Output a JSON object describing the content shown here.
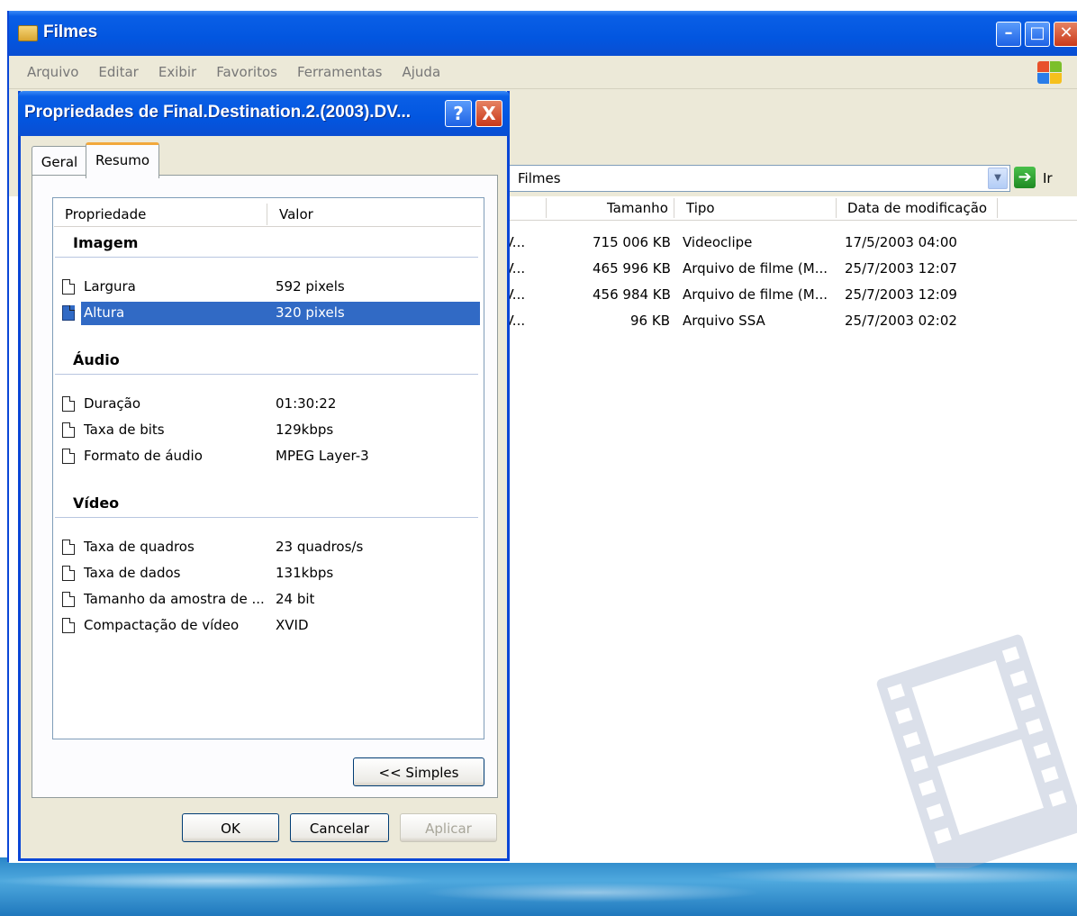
{
  "explorer": {
    "title": "Filmes",
    "menu": [
      "Arquivo",
      "Editar",
      "Exibir",
      "Favoritos",
      "Ferramentas",
      "Ajuda"
    ],
    "address": "Filmes",
    "go_label": "Ir",
    "columns": {
      "tamanho": "Tamanho",
      "tipo": "Tipo",
      "data": "Data de modificação"
    },
    "files": [
      {
        "name": "CV...",
        "size": "715 006 KB",
        "type": "Videoclipe",
        "date": "17/5/2003 04:00"
      },
      {
        "name": "CV...",
        "size": "465 996 KB",
        "type": "Arquivo de filme (M...",
        "date": "25/7/2003 12:07"
      },
      {
        "name": "CV...",
        "size": "456 984 KB",
        "type": "Arquivo de filme (M...",
        "date": "25/7/2003 12:09"
      },
      {
        "name": "CV...",
        "size": "96 KB",
        "type": "Arquivo SSA",
        "date": "25/7/2003 02:02"
      }
    ]
  },
  "dialog": {
    "title": "Propriedades de Final.Destination.2.(2003).DV...",
    "help_label": "?",
    "close_label": "X",
    "tabs": [
      "Geral",
      "Resumo"
    ],
    "list_header": {
      "propriedade": "Propriedade",
      "valor": "Valor"
    },
    "groups": {
      "imagem": "Imagem",
      "audio": "Áudio",
      "video": "Vídeo"
    },
    "imagem_rows": [
      {
        "name": "Largura",
        "value": "592 pixels"
      },
      {
        "name": "Altura",
        "value": "320 pixels"
      }
    ],
    "audio_rows": [
      {
        "name": "Duração",
        "value": "01:30:22"
      },
      {
        "name": "Taxa de bits",
        "value": "129kbps"
      },
      {
        "name": "Formato de áudio",
        "value": "MPEG Layer-3"
      }
    ],
    "video_rows": [
      {
        "name": "Taxa de quadros",
        "value": "23 quadros/s"
      },
      {
        "name": "Taxa de dados",
        "value": "131kbps"
      },
      {
        "name": "Tamanho da amostra de ...",
        "value": "24 bit"
      },
      {
        "name": "Compactação de vídeo",
        "value": "XVID"
      }
    ],
    "simples_button": "<< Simples",
    "ok_button": "OK",
    "cancel_button": "Cancelar",
    "apply_button": "Aplicar"
  },
  "colors": {
    "titlebar": "#0256e0",
    "selection": "#316ac5",
    "tab_accent": "#f2a83c"
  }
}
